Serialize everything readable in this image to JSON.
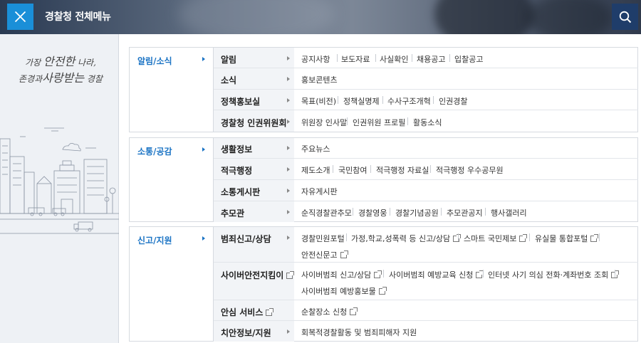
{
  "header": {
    "title": "경찰청 전체메뉴",
    "close_icon": "close-icon",
    "search_icon": "search-icon",
    "close_color": "#1a8fd8",
    "search_color": "#1f3d6a"
  },
  "slogan": {
    "line1_small_a": "가장 ",
    "line1_large": "안전한",
    "line1_small_b": " 나라,",
    "line2_small_a": "존경과",
    "line2_large": "사랑받는",
    "line2_small_b": " 경찰"
  },
  "menu": {
    "accent_color": "#1a73c4",
    "groups": [
      {
        "label": "알림/소식",
        "rows": [
          {
            "label": "알림",
            "links": [
              "공지사항",
              "보도자료",
              "사실확인",
              "채용공고",
              "입찰공고"
            ]
          },
          {
            "label": "소식",
            "links": [
              "홍보콘텐츠"
            ]
          },
          {
            "label": "정책홍보실",
            "links": [
              "목표(비전)",
              "정책실명제",
              "수사구조개혁",
              "인권경찰"
            ]
          },
          {
            "label": "경찰청 인권위원회",
            "links": [
              "위원장 인사말",
              "인권위원 프로필",
              "활동소식"
            ]
          }
        ]
      },
      {
        "label": "소통/공감",
        "rows": [
          {
            "label": "생활정보",
            "links": [
              "주요뉴스"
            ]
          },
          {
            "label": "적극행정",
            "links": [
              "제도소개",
              "국민참여",
              "적극행정 자료실",
              "적극행정 우수공무원"
            ]
          },
          {
            "label": "소통게시판",
            "links": [
              "자유게시판"
            ]
          },
          {
            "label": "추모관",
            "links": [
              "순직경찰관추모",
              "경찰영웅",
              "경찰기념공원",
              "추모관공지",
              "행사갤러리"
            ]
          }
        ]
      },
      {
        "label": "신고/지원",
        "rows": [
          {
            "label": "범죄신고/상담",
            "links": [
              "경찰민원포털",
              "가정,학교,성폭력 등 신고/상담",
              "스마트 국민제보",
              "유실물 통합포털",
              "안전신문고"
            ]
          },
          {
            "label": "사이버안전지킴이",
            "links": [
              "사이버범죄 신고/상담",
              "사이버범죄 예방교육 신청",
              "인터넷 사기 의심 전화·계좌번호 조회",
              "사이버범죄 예방홍보물"
            ]
          },
          {
            "label": "안심 서비스",
            "links": [
              "순찰장소 신청"
            ]
          },
          {
            "label": "치안정보/지원",
            "links": [
              "회복적경찰활동 및 범죄피해자 지원"
            ]
          }
        ]
      }
    ]
  }
}
